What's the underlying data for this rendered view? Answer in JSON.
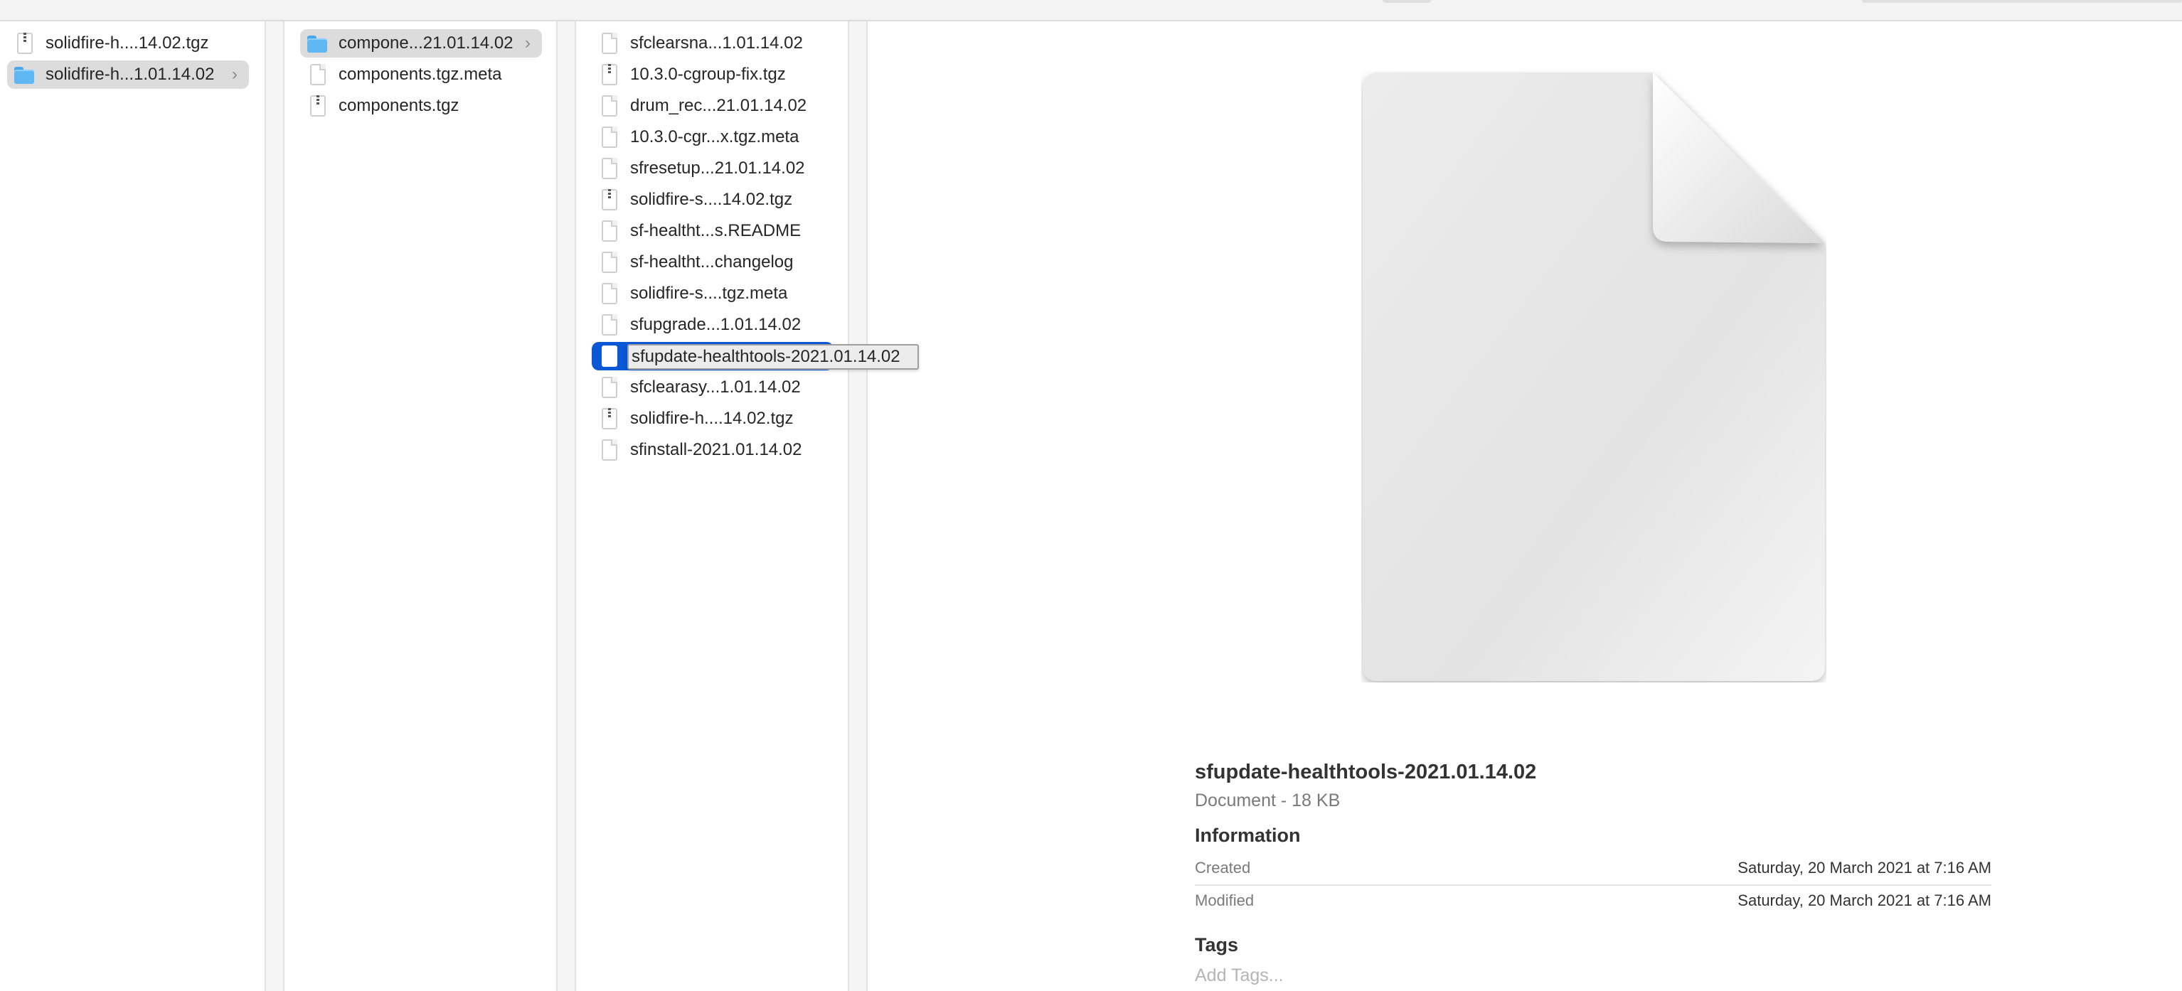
{
  "colors": {
    "selection_blue": "#0b58d6",
    "selection_gray": "#dcdcdc",
    "folder_blue": "#5fb7f4"
  },
  "column1": {
    "items": [
      {
        "label": "solidfire-h....14.02.tgz",
        "icon": "archive-icon"
      },
      {
        "label": "solidfire-h...1.01.14.02",
        "icon": "folder-icon",
        "chevron": "›"
      }
    ]
  },
  "column2": {
    "items": [
      {
        "label": "compone...21.01.14.02",
        "icon": "folder-icon",
        "chevron": "›"
      },
      {
        "label": "components.tgz.meta",
        "icon": "document-icon"
      },
      {
        "label": "components.tgz",
        "icon": "archive-icon"
      }
    ]
  },
  "column3": {
    "items": [
      {
        "label": "sfclearsna...1.01.14.02",
        "icon": "document-icon"
      },
      {
        "label": "10.3.0-cgroup-fix.tgz",
        "icon": "archive-icon"
      },
      {
        "label": "drum_rec...21.01.14.02",
        "icon": "document-icon"
      },
      {
        "label": "10.3.0-cgr...x.tgz.meta",
        "icon": "document-icon"
      },
      {
        "label": "sfresetup...21.01.14.02",
        "icon": "document-icon"
      },
      {
        "label": "solidfire-s....14.02.tgz",
        "icon": "archive-icon"
      },
      {
        "label": "sf-healtht...s.README",
        "icon": "document-icon"
      },
      {
        "label": "sf-healtht...changelog",
        "icon": "document-icon"
      },
      {
        "label": "solidfire-s....tgz.meta",
        "icon": "document-icon"
      },
      {
        "label": "sfupgrade...1.01.14.02",
        "icon": "document-icon"
      },
      {
        "label": "",
        "icon": "document-icon"
      },
      {
        "label": "sfclearasy...1.01.14.02",
        "icon": "document-icon"
      },
      {
        "label": "solidfire-h....14.02.tgz",
        "icon": "archive-icon"
      },
      {
        "label": "sfinstall-2021.01.14.02",
        "icon": "document-icon"
      }
    ],
    "rename_value": "sfupdate-healthtools-2021.01.14.02"
  },
  "preview": {
    "filename": "sfupdate-healthtools-2021.01.14.02",
    "kind": "Document - 18 KB",
    "information_heading": "Information",
    "created_label": "Created",
    "created_value": "Saturday, 20 March 2021 at 7:16 AM",
    "modified_label": "Modified",
    "modified_value": "Saturday, 20 March 2021 at 7:16 AM",
    "tags_heading": "Tags",
    "tags_placeholder": "Add Tags..."
  }
}
